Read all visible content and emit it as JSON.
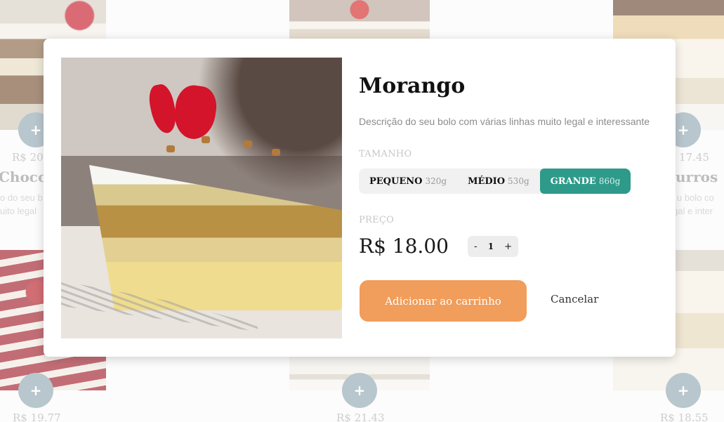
{
  "background_products": [
    {
      "price": "R$ 20",
      "name": "Choco",
      "desc_line1": "o do seu b",
      "desc_line2": "uito legal"
    },
    {
      "price": "17.45",
      "name": "urros",
      "desc_line1": "u bolo co",
      "desc_line2": "gal e inter"
    },
    {
      "price": "R$ 19.77"
    },
    {
      "price": "R$ 21.43"
    },
    {
      "price": "R$ 18.55"
    }
  ],
  "plus_symbol": "+",
  "modal": {
    "title": "Morango",
    "description": "Descrição do seu bolo com várias linhas muito legal e interessante",
    "size_label": "TAMANHO",
    "sizes": [
      {
        "name": "PEQUENO",
        "weight": "320g"
      },
      {
        "name": "MÉDIO",
        "weight": "530g"
      },
      {
        "name": "GRANDE",
        "weight": "860g"
      }
    ],
    "selected_size": "GRANDE",
    "price_label": "PREÇO",
    "price": "R$ 18.00",
    "quantity": {
      "minus": "-",
      "value": "1",
      "plus": "+"
    },
    "add_button": "Adicionar ao carrinho",
    "cancel_button": "Cancelar"
  },
  "colors": {
    "accent_teal": "#2e9a8a",
    "add_button": "#f19d5b",
    "plus_circle": "#93a8b2"
  }
}
